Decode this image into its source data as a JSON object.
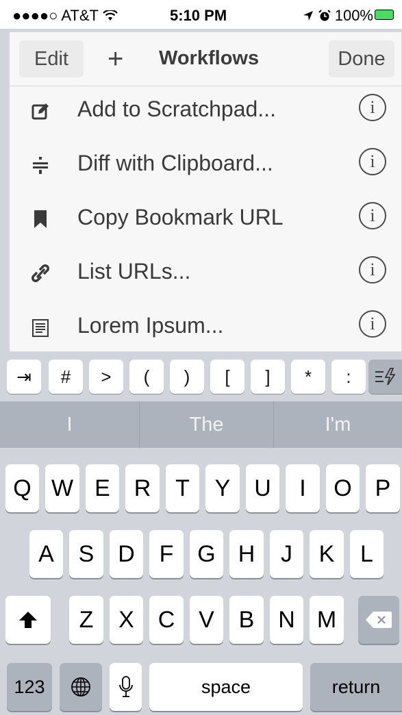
{
  "status": {
    "signal": "●●●●○",
    "carrier": "AT&T",
    "time": "5:10 PM",
    "battery": "100%",
    "indicator_icons": [
      "location-arrow-icon",
      "alarm-icon"
    ]
  },
  "nav": {
    "edit_label": "Edit",
    "title": "Workflows",
    "done_label": "Done"
  },
  "workflows": [
    {
      "label": "Add to Scratchpad...",
      "icon": "edit-icon"
    },
    {
      "label": "Diff with Clipboard...",
      "icon": "diff-icon"
    },
    {
      "label": "Copy Bookmark URL",
      "icon": "bookmark-icon"
    },
    {
      "label": "List URLs...",
      "icon": "link-icon"
    },
    {
      "label": "Lorem Ipsum...",
      "icon": "document-icon"
    }
  ],
  "extra_keys": [
    "⇥",
    "#",
    ">",
    "(",
    ")",
    "[",
    "]",
    "*",
    ":"
  ],
  "suggestions": [
    "I",
    "The",
    "I'm"
  ],
  "keyboard": {
    "row1": [
      "Q",
      "W",
      "E",
      "R",
      "T",
      "Y",
      "U",
      "I",
      "O",
      "P"
    ],
    "row2": [
      "A",
      "S",
      "D",
      "F",
      "G",
      "H",
      "J",
      "K",
      "L"
    ],
    "row3": [
      "Z",
      "X",
      "C",
      "V",
      "B",
      "N",
      "M"
    ],
    "numbers_label": "123",
    "space_label": "space",
    "return_label": "return"
  },
  "colors": {
    "keyboard_bg": "#d1d5db",
    "suggestion_bg": "#acb3bd",
    "battery_green": "#4cd964"
  }
}
